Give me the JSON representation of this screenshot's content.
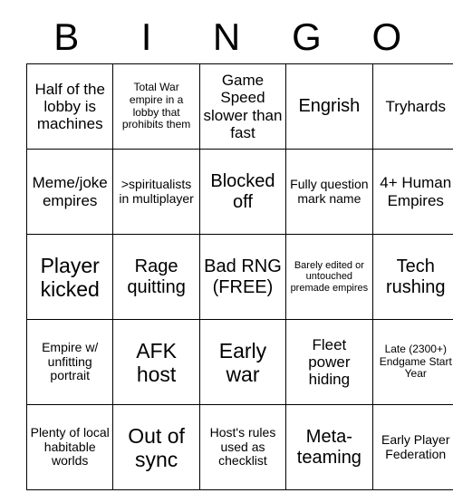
{
  "card": {
    "header_letters": [
      "B",
      "I",
      "N",
      "G",
      "O"
    ],
    "rows": [
      [
        {
          "text": "Half of the lobby is machines",
          "size": "fs-md"
        },
        {
          "text": "Total War empire in a lobby that prohibits them",
          "size": "fs-xs"
        },
        {
          "text": "Game Speed slower than fast",
          "size": "fs-md"
        },
        {
          "text": "Engrish",
          "size": "fs-lg"
        },
        {
          "text": "Tryhards",
          "size": "fs-md"
        }
      ],
      [
        {
          "text": "Meme/joke empires",
          "size": "fs-md"
        },
        {
          "text": ">spiritualists in multiplayer",
          "size": "fs-sm"
        },
        {
          "text": "Blocked off",
          "size": "fs-lg"
        },
        {
          "text": "Fully question mark name",
          "size": "fs-sm"
        },
        {
          "text": "4+ Human Empires",
          "size": "fs-md"
        }
      ],
      [
        {
          "text": "Player kicked",
          "size": "fs-xl"
        },
        {
          "text": "Rage quitting",
          "size": "fs-lg"
        },
        {
          "text": "Bad RNG (FREE)",
          "size": "fs-lg"
        },
        {
          "text": "Barely edited or untouched premade empires",
          "size": "fs-xxs"
        },
        {
          "text": "Tech rushing",
          "size": "fs-lg"
        }
      ],
      [
        {
          "text": "Empire w/ unfitting portrait",
          "size": "fs-sm"
        },
        {
          "text": "AFK host",
          "size": "fs-xl"
        },
        {
          "text": "Early war",
          "size": "fs-xl"
        },
        {
          "text": "Fleet power hiding",
          "size": "fs-md"
        },
        {
          "text": "Late (2300+) Endgame Start Year",
          "size": "fs-xs"
        }
      ],
      [
        {
          "text": "Plenty of local habitable worlds",
          "size": "fs-sm"
        },
        {
          "text": "Out of sync",
          "size": "fs-xl"
        },
        {
          "text": "Host's rules used as checklist",
          "size": "fs-sm"
        },
        {
          "text": "Meta-teaming",
          "size": "fs-lg"
        },
        {
          "text": "Early Player Federation",
          "size": "fs-sm"
        }
      ]
    ]
  }
}
